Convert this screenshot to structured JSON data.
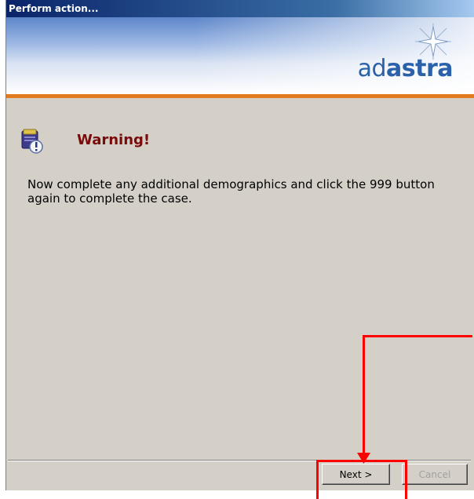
{
  "window": {
    "title": "Perform action..."
  },
  "brand": {
    "logo_light": "ad",
    "logo_bold": "astra"
  },
  "dialog": {
    "heading": "Warning!",
    "message": "Now complete any additional demographics and click the 999 button again to complete the case."
  },
  "buttons": {
    "next_label": "Next >",
    "cancel_label": "Cancel"
  },
  "colors": {
    "accent_orange": "#e27a1f",
    "warning_red": "#7a0b0b",
    "annotation_red": "#ff0000"
  },
  "icons": {
    "dialog_icon": "warning-info-icon"
  }
}
